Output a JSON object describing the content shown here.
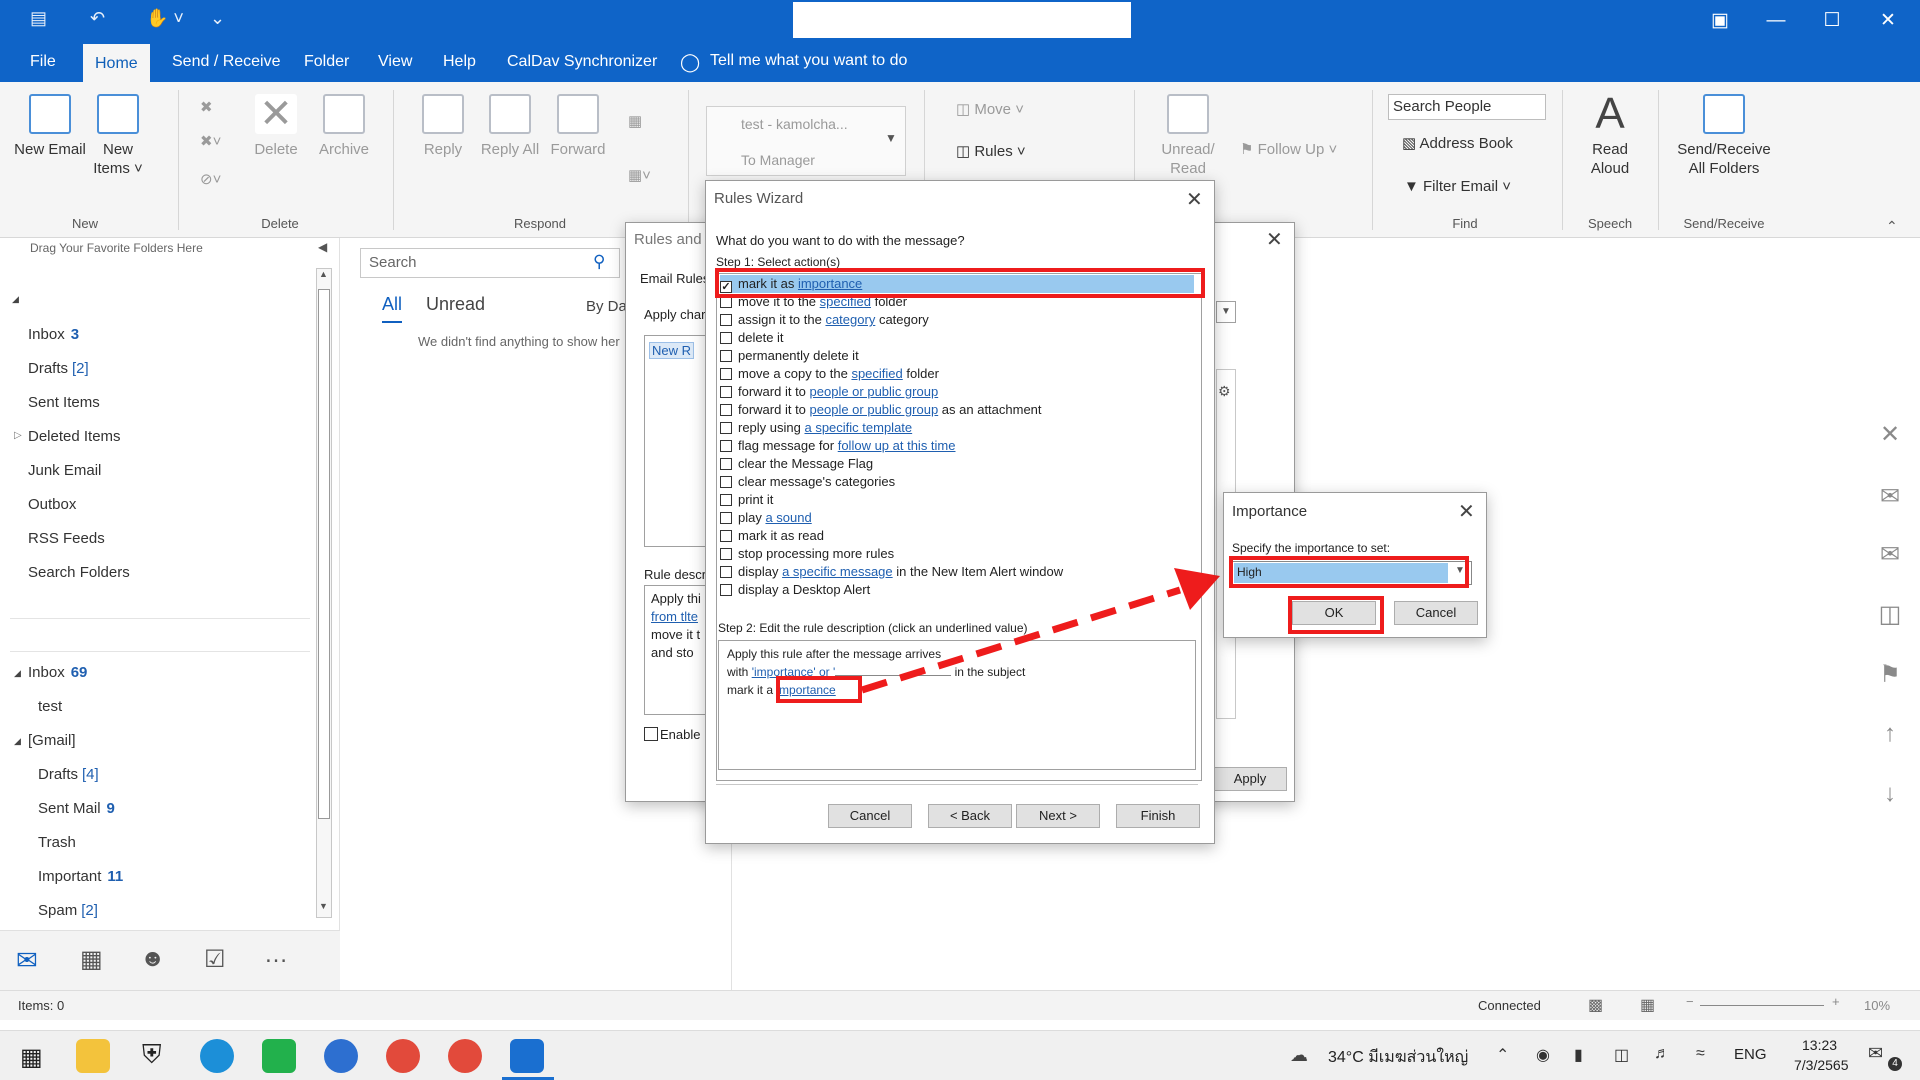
{
  "titlebar": {
    "quick_access": [
      "app-icon",
      "undo-icon",
      "touch-mode-icon",
      "customize-icon"
    ]
  },
  "ribbon_tabs": [
    "File",
    "Home",
    "Send / Receive",
    "Folder",
    "View",
    "Help",
    "CalDav Synchronizer"
  ],
  "tell_me": "Tell me what you want to do",
  "ribbon": {
    "new_email": "New Email",
    "new_items": "New Items",
    "delete": "Delete",
    "archive": "Archive",
    "reply": "Reply",
    "reply_all": "Reply All",
    "forward": "Forward",
    "quick_step_1": "test - kamolcha...",
    "quick_step_2": "To Manager",
    "move": "Move",
    "rules": "Rules",
    "unread_read": "Unread/ Read",
    "follow_up": "Follow Up",
    "search_people": "Search People",
    "address_book": "Address Book",
    "filter_email": "Filter Email",
    "read_aloud": "Read Aloud",
    "send_receive_all": "Send/Receive All Folders",
    "groups": {
      "new": "New",
      "delete": "Delete",
      "respond": "Respond",
      "find": "Find",
      "speech": "Speech",
      "send_receive": "Send/Receive"
    }
  },
  "folders": {
    "favorites_hint": "Drag Your Favorite Folders Here",
    "items": [
      {
        "name": "Inbox",
        "count": "3"
      },
      {
        "name": "Drafts",
        "bracket": "[2]"
      },
      {
        "name": "Sent Items"
      },
      {
        "name": "Deleted Items"
      },
      {
        "name": "Junk Email"
      },
      {
        "name": "Outbox"
      },
      {
        "name": "RSS Feeds"
      },
      {
        "name": "Search Folders"
      }
    ],
    "account2": [
      {
        "name": "Inbox",
        "count": "69"
      },
      {
        "name": "test"
      },
      {
        "name": "[Gmail]"
      },
      {
        "name": "Drafts",
        "bracket": "[4]"
      },
      {
        "name": "Sent Mail",
        "count": "9"
      },
      {
        "name": "Trash"
      },
      {
        "name": "Important",
        "count": "11"
      },
      {
        "name": "Spam",
        "bracket": "[2]"
      }
    ]
  },
  "message_list": {
    "search_placeholder": "Search",
    "filter_all": "All",
    "filter_unread": "Unread",
    "sort": "By Da",
    "empty": "We didn't find anything to show her"
  },
  "rules_and_alerts": {
    "title": "Rules and A",
    "tab": "Email Rules",
    "apply_changes": "Apply char",
    "new_rule": "New R",
    "rule_desc": "Rule descr",
    "desc_lines": [
      "Apply thi",
      "from tlte",
      "move it t",
      "and sto"
    ],
    "enable": "Enable",
    "apply": "Apply"
  },
  "rules_wizard": {
    "title": "Rules Wizard",
    "question": "What do you want to do with the message?",
    "step1": "Step 1: Select action(s)",
    "actions": [
      {
        "text": "mark it as ",
        "link": "importance",
        "checked": true
      },
      {
        "text": "move it to the ",
        "link": "specified",
        "after": " folder"
      },
      {
        "text": "assign it to the ",
        "link": "category",
        "after": " category"
      },
      {
        "text": "delete it"
      },
      {
        "text": "permanently delete it"
      },
      {
        "text": "move a copy to the ",
        "link": "specified",
        "after": " folder"
      },
      {
        "text": "forward it to ",
        "link": "people or public group"
      },
      {
        "text": "forward it to ",
        "link": "people or public group",
        "after": " as an attachment"
      },
      {
        "text": "reply using ",
        "link": "a specific template"
      },
      {
        "text": "flag message for ",
        "link": "follow up at this time"
      },
      {
        "text": "clear the Message Flag"
      },
      {
        "text": "clear message's categories"
      },
      {
        "text": "print it"
      },
      {
        "text": "play ",
        "link": "a sound"
      },
      {
        "text": "mark it as read"
      },
      {
        "text": "stop processing more rules"
      },
      {
        "text": "display ",
        "link": "a specific message",
        "after": " in the New Item Alert window"
      },
      {
        "text": "display a Desktop Alert"
      }
    ],
    "step2": "Step 2: Edit the rule description (click an underlined value)",
    "desc1": "Apply this rule after the message arrives",
    "desc2_pre": "with ",
    "desc2_link": "'importance' or '",
    "desc2_post": " in the subject",
    "desc3_pre": "mark it a",
    "desc3_link": "importance",
    "cancel": "Cancel",
    "back": "< Back",
    "next": "Next >",
    "finish": "Finish"
  },
  "importance": {
    "title": "Importance",
    "label": "Specify the importance to set:",
    "value": "High",
    "ok": "OK",
    "cancel": "Cancel"
  },
  "status": {
    "items": "Items: 0",
    "connected": "Connected",
    "zoom": "10%"
  },
  "taskbar": {
    "weather": "34°C มีเมฆส่วนใหญ่",
    "lang": "ENG",
    "time": "13:23",
    "date": "7/3/2565",
    "notif": "4"
  },
  "colors": {
    "accent": "#0f64c8",
    "link": "#1f5fb0",
    "highlight": "#ee1c1c",
    "selection": "#99c9ef"
  }
}
